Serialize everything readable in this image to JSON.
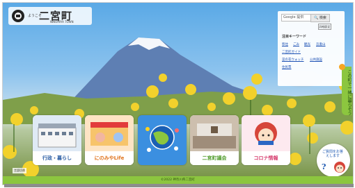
{
  "header": {
    "logo_small": "ようこそ",
    "logo_title": "二宮町",
    "logo_sub": "NINOMIYA TOWN"
  },
  "search": {
    "placeholder": "Google 提供",
    "button_label": "検索",
    "detail_link": "詳細設定"
  },
  "keywords": {
    "title": "注目キーワード",
    "items": [
      "移住",
      "ごみ",
      "観光",
      "吾妻山",
      "二宮町ガイド",
      "菜の花ウォッチ",
      "公共施設",
      "住民票"
    ]
  },
  "side_tab": {
    "label": "この町で一緒に暮らそう"
  },
  "cards": [
    {
      "label": "行政・暮らし",
      "color": "#5a8fd6"
    },
    {
      "label": "にのみやLife",
      "color": "#f08a2c"
    },
    {
      "label": "",
      "color": "#2b7fd3"
    },
    {
      "label": "二宮町議会",
      "color": "#6fba3f"
    },
    {
      "label": "コロナ情報",
      "color": "#e0487a"
    }
  ],
  "mascot_bubble": {
    "text": "ご質問をお答えします",
    "mark": "?"
  },
  "language_switch": "言語切替",
  "footer": {
    "copyright": "©2022 神奈川県二宮町"
  }
}
